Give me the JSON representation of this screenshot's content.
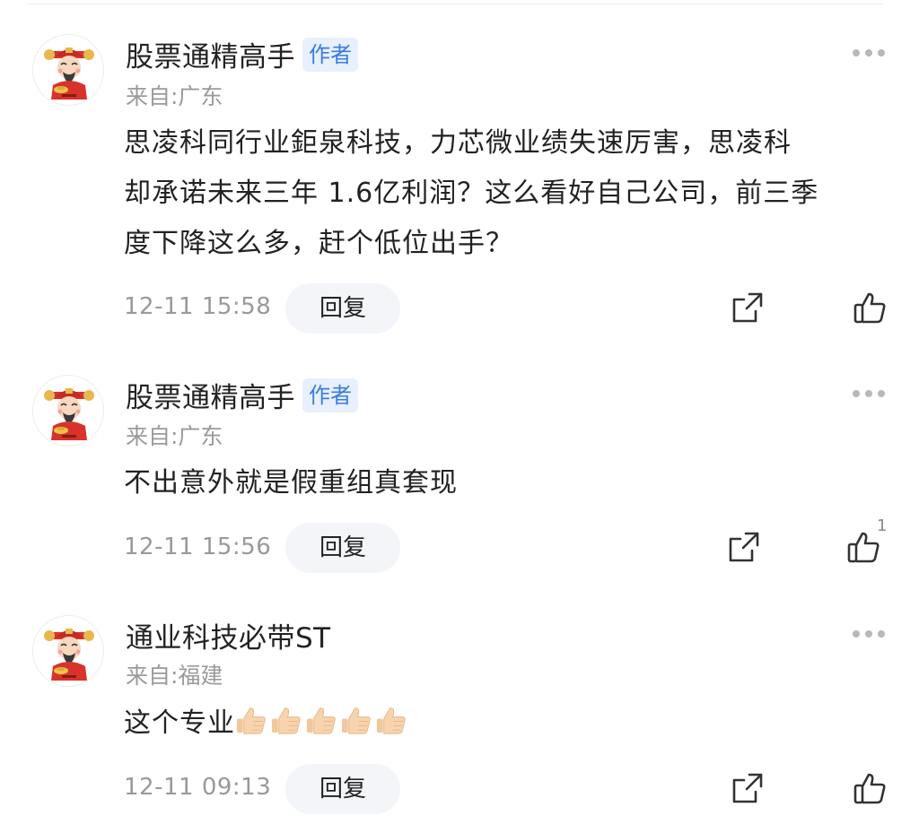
{
  "comments": [
    {
      "username": "股票通精高手",
      "badge": "作者",
      "location": "来自:广东",
      "lines": [
        "思凌科同行业鉅泉科技，力芯微业绩失速厉害，思凌科",
        "却承诺未来三年 1.6亿利润？这么看好自己公司，前三季",
        "度下降这么多，赶个低位出手？"
      ],
      "time": "12-11 15:58",
      "reply_label": "回复",
      "likes": ""
    },
    {
      "username": "股票通精高手",
      "badge": "作者",
      "location": "来自:广东",
      "lines": [
        "不出意外就是假重组真套现"
      ],
      "time": "12-11 15:56",
      "reply_label": "回复",
      "likes": "1"
    },
    {
      "username": "通业科技必带ST",
      "badge": "",
      "location": "来自:福建",
      "text": "这个专业",
      "emojis": [
        "thumbs-up",
        "thumbs-up",
        "thumbs-up",
        "thumbs-up",
        "thumbs-up"
      ],
      "time": "12-11 09:13",
      "reply_label": "回复",
      "likes": ""
    }
  ]
}
